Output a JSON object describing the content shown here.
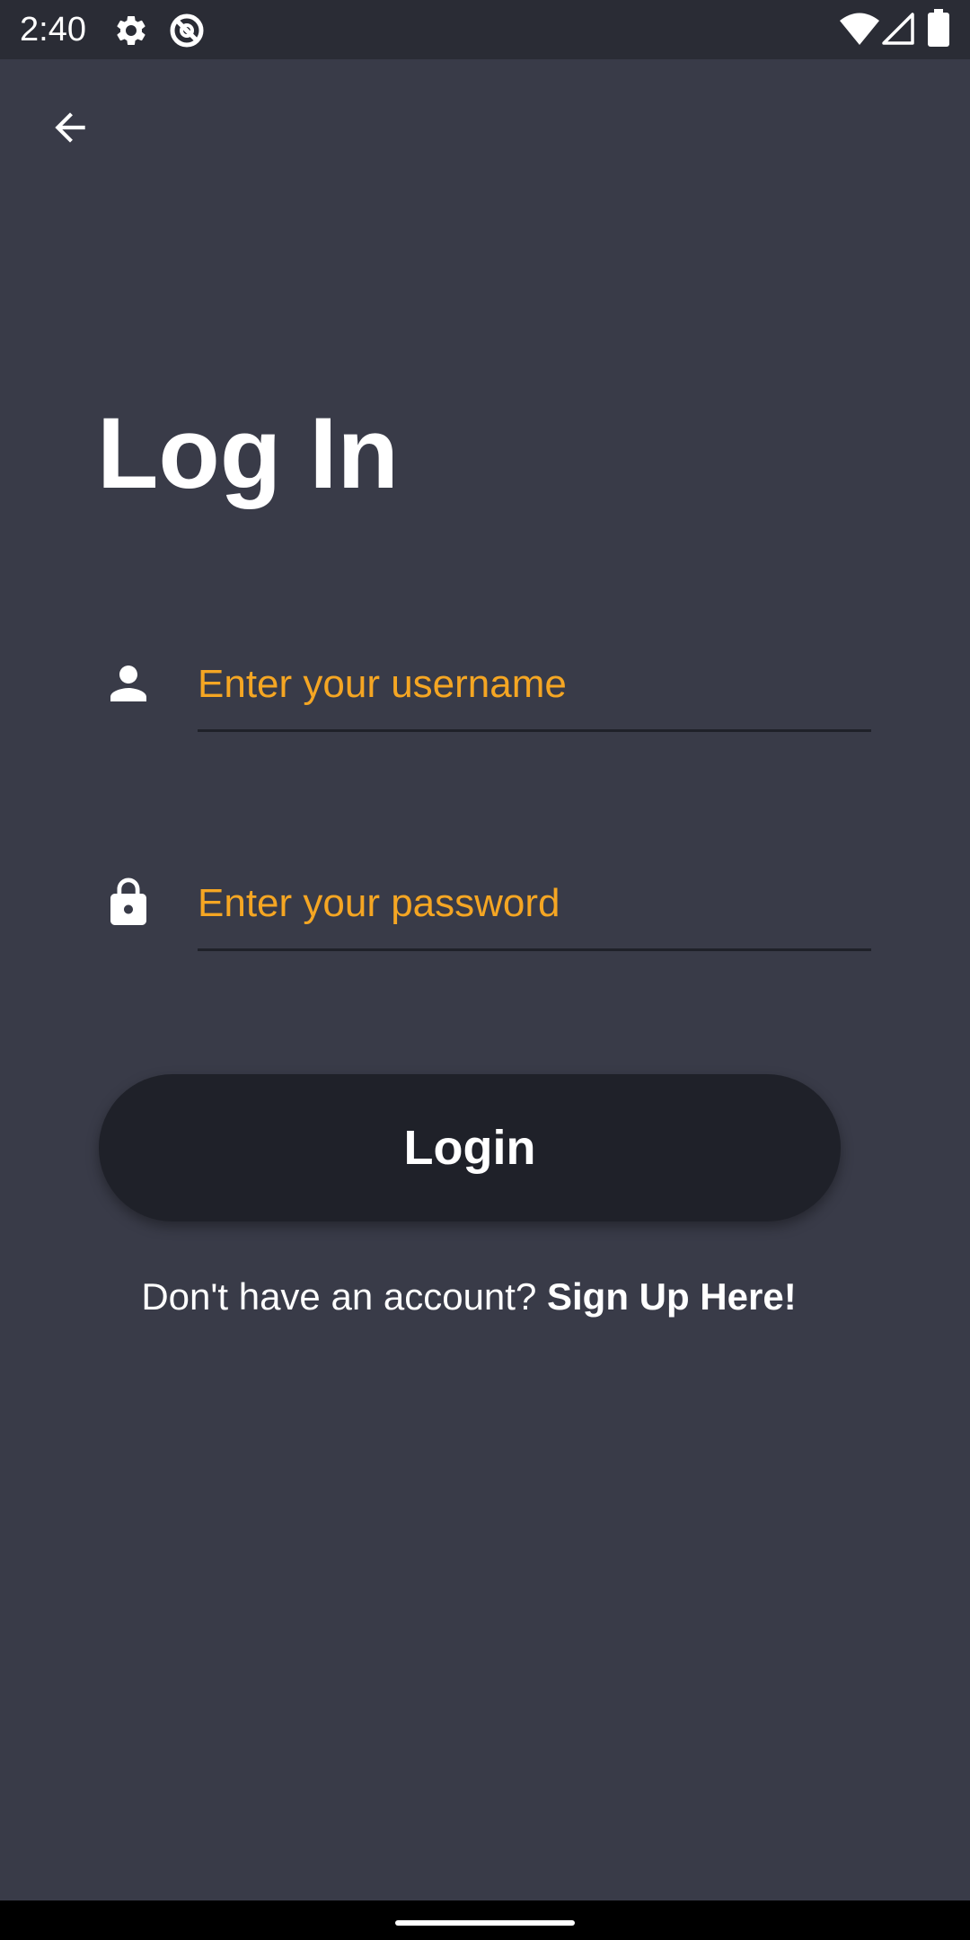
{
  "status_bar": {
    "time": "2:40",
    "icons": [
      "settings-icon",
      "vpn-icon",
      "wifi-icon",
      "signal-icon",
      "battery-icon"
    ]
  },
  "header": {
    "back_icon": "arrow-left-icon"
  },
  "login": {
    "title": "Log In",
    "username_placeholder": "Enter your username",
    "password_placeholder": "Enter your password",
    "username_icon": "person-icon",
    "password_icon": "lock-icon",
    "login_button_label": "Login",
    "signup_prompt": "Don't have an account?",
    "signup_link": "Sign Up Here!"
  },
  "colors": {
    "background": "#393b48",
    "status_bar": "#2a2c35",
    "button_bg": "#1f2129",
    "placeholder_accent": "#f5a623",
    "text": "#ffffff"
  }
}
